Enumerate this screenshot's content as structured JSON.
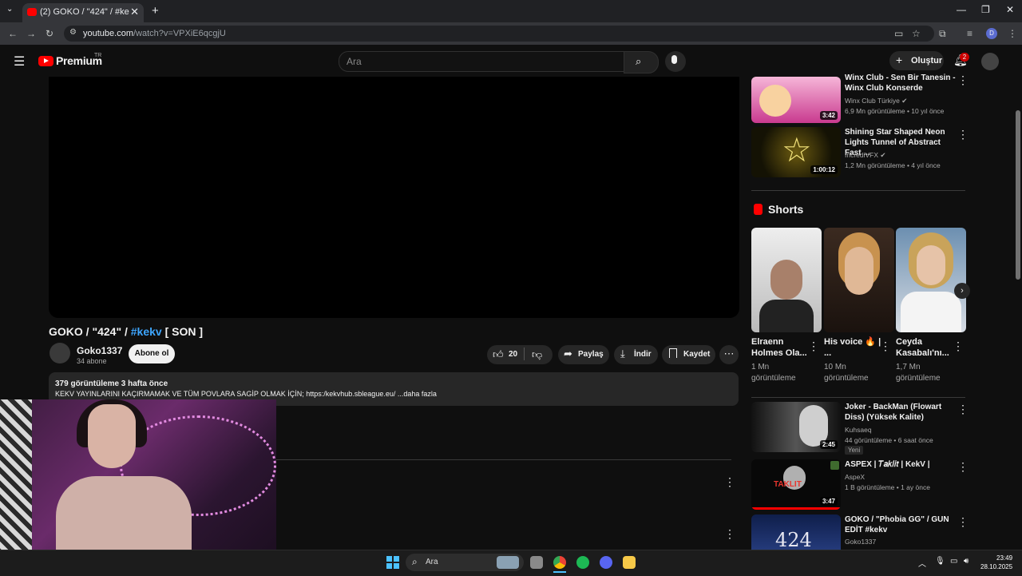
{
  "browser": {
    "tab_title": "(2) GOKO / \"424\" / #kekv [ SON ]",
    "url_host": "youtube.com",
    "url_path": "/watch?v=VPXiE6qcgjU"
  },
  "yt_header": {
    "logo_text": "Premium",
    "logo_badge": "TR",
    "search_placeholder": "Ara",
    "create_label": "Oluştur",
    "notification_count": "2"
  },
  "video": {
    "title_prefix": "GOKO / \"424\" / ",
    "title_tag": "#kekv",
    "title_suffix": " [ SON ]",
    "channel": "Goko1337",
    "subscribers": "34 abone",
    "subscribe_label": "Abone ol",
    "likes": "20",
    "share_label": "Paylaş",
    "download_label": "İndir",
    "save_label": "Kaydet",
    "views_date": "379 görüntüleme  3 hafta önce",
    "description": "KEKV YAYINLARINI KAÇIRMAMAK VE TÜM POVLARA SAGİP OLMAK İÇİN; https:/kekvhub.sbleague.eu/ ...daha fazla"
  },
  "recommended_top": [
    {
      "title": "Winx Club - Sen Bir Tanesin - Winx Club Konserde",
      "channel": "Winx Club Türkiye",
      "meta": "6,9 Mn görüntüleme • 10 yıl önce",
      "duration": "3:42"
    },
    {
      "title": "Shining Star Shaped Neon Lights Tunnel of Abstract Fast ...",
      "channel": "IncrediVFX",
      "meta": "1,2 Mn görüntüleme • 4 yıl önce",
      "duration": "1:00:12"
    }
  ],
  "shorts": {
    "header": "Shorts",
    "items": [
      {
        "title": "Elraenn Holmes Ola...",
        "views": "1 Mn görüntüleme"
      },
      {
        "title": "His voice 🔥 | ...",
        "views": "10 Mn görüntüleme"
      },
      {
        "title": "Ceyda Kasabalı'nı...",
        "views": "1,7 Mn görüntüleme"
      }
    ]
  },
  "recommended_bottom": [
    {
      "title": "Joker - BackMan (Flowart Diss) (Yüksek Kalite)",
      "channel": "Kuhsaeq",
      "meta": "44 görüntüleme • 6 saat önce",
      "duration": "2:45",
      "badge": "Yeni"
    },
    {
      "title": "ASPEX | 𝑇𝑎𝑘𝑙𝑖𝑡 | KekV |",
      "channel": "AspeX",
      "meta": "1 B görüntüleme • 1 ay önce",
      "duration": "3:47",
      "thumb_text": "TAKLIT"
    },
    {
      "title": "GOKO / \"Phobia GG\" / GUN EDİT #kekv",
      "channel": "Goko1337",
      "thumb_text": "424"
    }
  ],
  "taskbar": {
    "search_label": "Ara",
    "time": "23:49",
    "date": "28.10.2025"
  },
  "colors": {
    "background": "#0f0f0f",
    "brand_red": "#ff0000",
    "link_blue": "#3ea6ff",
    "pill_gray": "#272727"
  }
}
